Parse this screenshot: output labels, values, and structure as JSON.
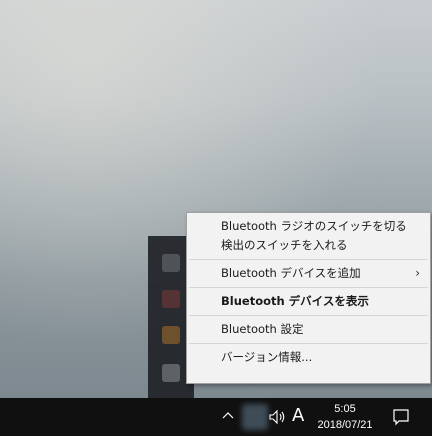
{
  "context_menu": {
    "items": [
      {
        "label": "Bluetooth ラジオのスイッチを切る"
      },
      {
        "label": "検出のスイッチを入れる"
      },
      {
        "label": "Bluetooth デバイスを追加",
        "submenu_glyph": "›"
      },
      {
        "label": "Bluetooth デバイスを表示"
      },
      {
        "label": "Bluetooth 設定"
      },
      {
        "label": "バージョン情報..."
      }
    ]
  },
  "taskbar": {
    "ime_indicator": "A",
    "time": "5:05",
    "date": "2018/07/21"
  },
  "icons": {
    "tray_overflow": "chevron-up-icon",
    "volume": "speaker-icon",
    "notifications": "action-center-icon"
  },
  "colors": {
    "taskbar": "#101010",
    "menu_bg": "#f2f2f2",
    "menu_border": "#a0a0a0"
  }
}
